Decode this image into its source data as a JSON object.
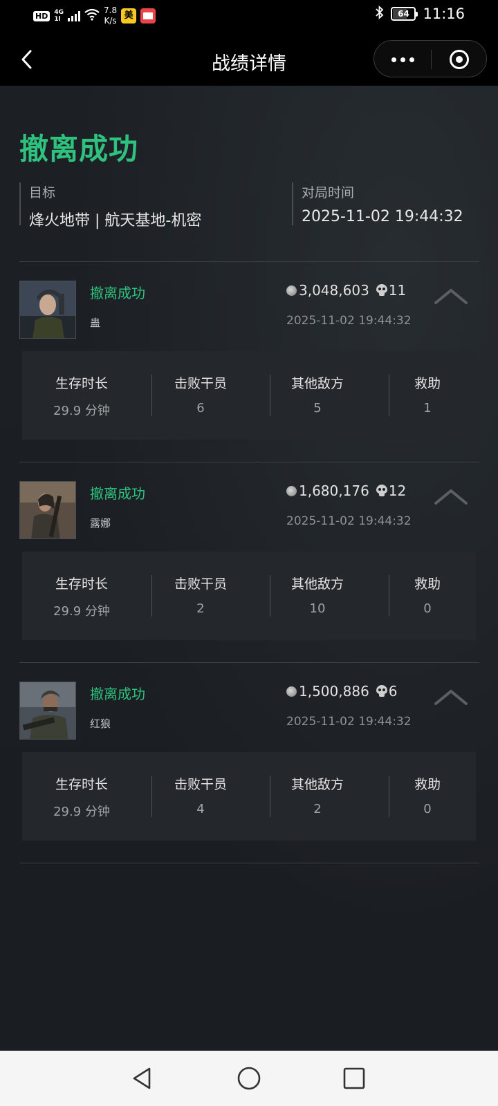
{
  "status_bar": {
    "hd": "HD",
    "network": "4G",
    "net_sub": "1l",
    "speed_value": "7.8",
    "speed_unit": "K/s",
    "app_badge": "美",
    "battery": "64",
    "battery_level": 0.64,
    "time": "11:16"
  },
  "nav": {
    "title": "战绩详情"
  },
  "summary": {
    "result": "撤离成功",
    "target_label": "目标",
    "target_value": "烽火地带 | 航天基地-机密",
    "time_label": "对局时间",
    "time_value": "2025-11-02 19:44:32"
  },
  "stat_labels": {
    "survival": "生存时长",
    "operators": "击败干员",
    "enemies": "其他敌方",
    "rescue": "救助"
  },
  "records": [
    {
      "status": "撤离成功",
      "hero": "蛊",
      "value": "3,048,603",
      "kills": "11",
      "time": "2025-11-02 19:44:32",
      "survival": "29.9 分钟",
      "operators": "6",
      "enemies": "5",
      "rescue": "1"
    },
    {
      "status": "撤离成功",
      "hero": "露娜",
      "value": "1,680,176",
      "kills": "12",
      "time": "2025-11-02 19:44:32",
      "survival": "29.9 分钟",
      "operators": "2",
      "enemies": "10",
      "rescue": "0"
    },
    {
      "status": "撤离成功",
      "hero": "红狼",
      "value": "1,500,886",
      "kills": "6",
      "time": "2025-11-02 19:44:32",
      "survival": "29.9 分钟",
      "operators": "4",
      "enemies": "2",
      "rescue": "0"
    }
  ],
  "colors": {
    "accent_green": "#2ec27e",
    "background": "#1a1d21",
    "panel": "#24282c"
  }
}
